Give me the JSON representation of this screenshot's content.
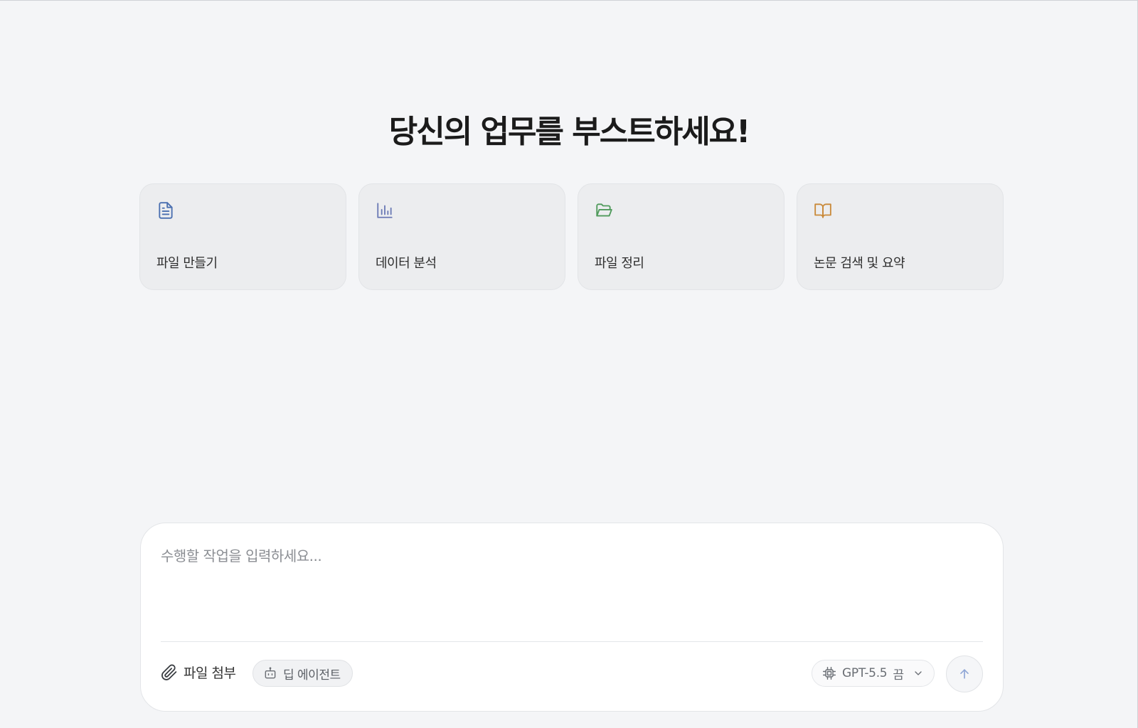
{
  "hero": {
    "title": "당신의 업무를 부스트하세요!"
  },
  "cards": [
    {
      "label": "파일 만들기",
      "icon": "file-text-icon",
      "color": "#4a6fb0"
    },
    {
      "label": "데이터 분석",
      "icon": "bar-chart-icon",
      "color": "#6b7ab5"
    },
    {
      "label": "파일 정리",
      "icon": "folder-open-icon",
      "color": "#4f9a5b"
    },
    {
      "label": "논문 검색 및 요약",
      "icon": "book-open-icon",
      "color": "#c98a3a"
    }
  ],
  "composer": {
    "placeholder": "수행할 작업을 입력하세요...",
    "value": "",
    "attach_label": "파일 첨부",
    "agent_label": "딥 에이전트",
    "model_label": "GPT-5.5",
    "model_mode": "끔",
    "icons": {
      "attach": "paperclip-icon",
      "agent": "robot-icon",
      "model": "cpu-chip-icon",
      "dropdown": "chevron-down-icon",
      "send": "arrow-up-icon"
    }
  },
  "colors": {
    "background": "#f4f5f7",
    "card_background": "#ecedef",
    "send_arrow": "#8fa6d6"
  }
}
